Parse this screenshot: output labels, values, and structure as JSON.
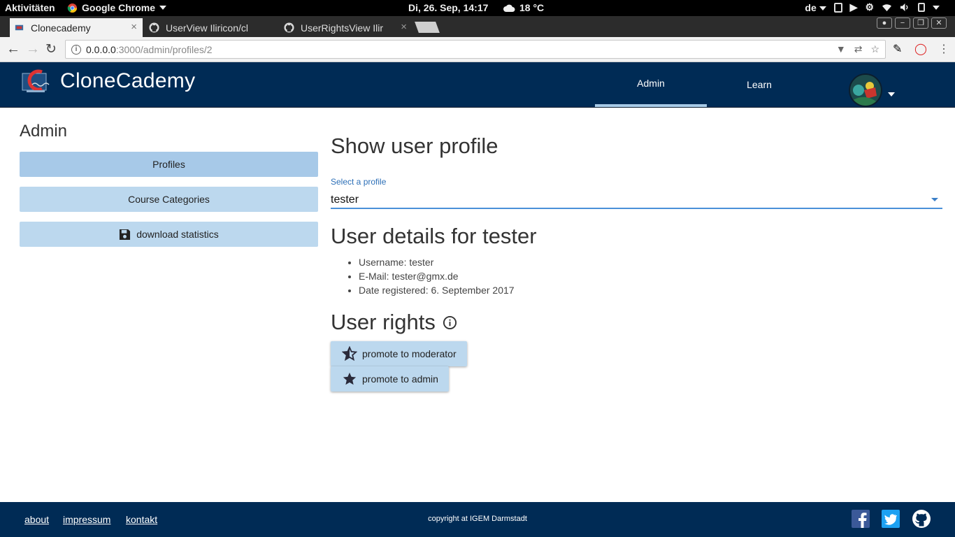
{
  "os_bar": {
    "activities": "Aktivitäten",
    "app_name": "Google Chrome",
    "clock": "Di, 26. Sep, 14:17",
    "weather": "18 °C",
    "lang": "de"
  },
  "browser": {
    "tabs": [
      {
        "title": "Clonecademy",
        "active": true
      },
      {
        "title": "UserView   Iliricon/cl",
        "active": false
      },
      {
        "title": "UserRightsView   Ilir",
        "active": false
      }
    ],
    "url_host": "0.0.0.0",
    "url_path": ":3000/admin/profiles/2"
  },
  "header": {
    "brand": "CloneCademy",
    "nav": [
      {
        "label": "Admin",
        "active": true
      },
      {
        "label": "Learn",
        "active": false
      }
    ]
  },
  "sidebar": {
    "title": "Admin",
    "items": [
      {
        "label": "Profiles",
        "selected": true
      },
      {
        "label": "Course Categories",
        "selected": false
      },
      {
        "label": "download statistics",
        "icon": "floppy-disk-icon",
        "selected": false
      }
    ]
  },
  "main": {
    "title": "Show user profile",
    "select_label": "Select a profile",
    "select_value": "tester",
    "details_title": "User details for tester",
    "details": [
      "Username: tester",
      "E-Mail: tester@gmx.de",
      "Date registered: 6. September 2017"
    ],
    "rights_title": "User rights",
    "rights_buttons": [
      {
        "label": "promote to moderator",
        "icon": "half-star-icon"
      },
      {
        "label": "promote to admin",
        "icon": "star-icon"
      }
    ]
  },
  "footer": {
    "links": [
      "about",
      "impressum",
      "kontakt"
    ],
    "copyright": "copyright at IGEM Darmstadt",
    "social": [
      "facebook-icon",
      "twitter-icon",
      "github-icon"
    ]
  },
  "colors": {
    "primary": "#002b55",
    "button": "#bcd8ee",
    "button_selected": "#a7c9e8",
    "accent": "#4a90d9"
  }
}
